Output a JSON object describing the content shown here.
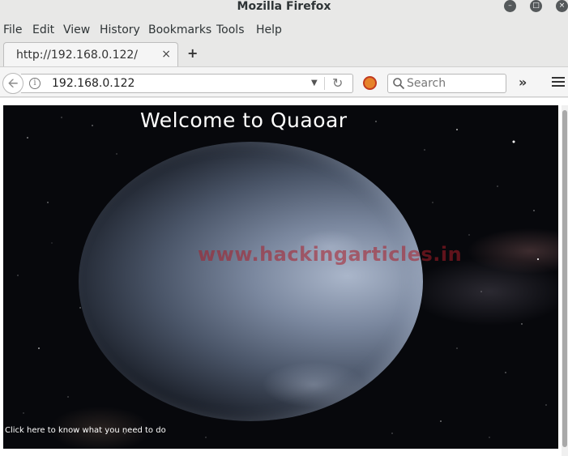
{
  "window": {
    "title": "Mozilla Firefox",
    "controls": [
      "minimize-icon",
      "maximize-icon",
      "close-icon"
    ]
  },
  "menubar": {
    "items": [
      "File",
      "Edit",
      "View",
      "History",
      "Bookmarks",
      "Tools",
      "Help"
    ]
  },
  "tabs": [
    {
      "label": "http://192.168.0.122/",
      "close": "×"
    }
  ],
  "newtab": {
    "label": "+"
  },
  "navbar": {
    "back_icon": "back-arrow-icon",
    "url": "192.168.0.122",
    "search_placeholder": "Search",
    "overflow": "»"
  },
  "page": {
    "title": "Welcome to Quaoar",
    "watermark": "www.hackingarticles.in",
    "link_text": "Click here to know what you need to do"
  }
}
